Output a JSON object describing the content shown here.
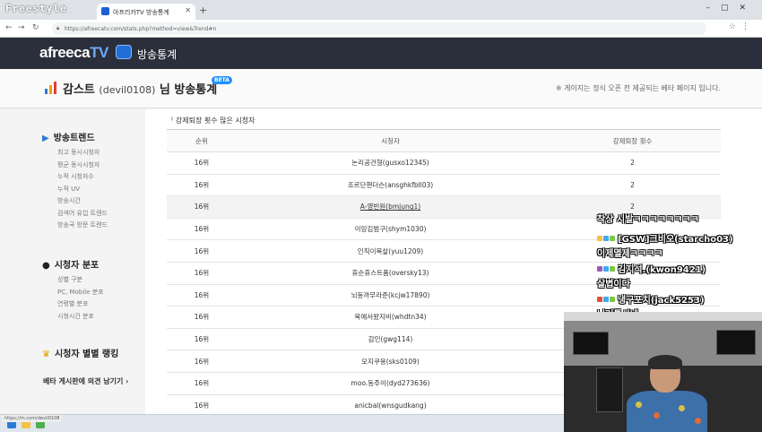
{
  "stream_logo": "Freestyle",
  "browser": {
    "tab_title": "아프리카TV 방송통계",
    "new_tab": "+",
    "url": "https://afreecatv.com/stats.php?method=view&Trend#n",
    "window_controls": "–▢✕"
  },
  "site": {
    "brand": "afreeca",
    "brand_tv": "TV",
    "section": "방송통계"
  },
  "title": {
    "name": "감스트",
    "user_id": "(devil0108)",
    "suffix": "님 방송통계",
    "beta": "BETA",
    "notice": "※ 게이지는 정식 오픈 전 제공되는 베타 페이지 입니다."
  },
  "sidebar": {
    "trend": {
      "label": "방송트렌드",
      "items": [
        "최고 동시시청자",
        "평균 동시시청자",
        "누적 시청자수",
        "누적 UV",
        "방송시간",
        "검색어 유입 트렌드",
        "방송국 방문 트렌드"
      ]
    },
    "viewers": {
      "label": "시청자 분포",
      "items": [
        "성별 구분",
        "PC, Mobile 분포",
        "연령별 분포",
        "시청시간 분포"
      ]
    },
    "ranking": {
      "label": "시청자 별별 랭킹"
    },
    "feedback": {
      "label": "베타 게시판에 의견 남기기 ›"
    }
  },
  "table": {
    "title": "강제퇴장 횟수 많은 시청자",
    "headers": [
      "순위",
      "시청자",
      "강제퇴장 횟수"
    ],
    "rows": [
      {
        "rank": "16위",
        "viewer": "논리공건형(gusxo12345)",
        "count": "2"
      },
      {
        "rank": "16위",
        "viewer": "조르단핸더슨(ansghkfbll03)",
        "count": "2"
      },
      {
        "rank": "16위",
        "viewer": "A-영빈원(bmjung1)",
        "count": "2"
      },
      {
        "rank": "16위",
        "viewer": "이잉김범구(shym1030)",
        "count": ""
      },
      {
        "rank": "16위",
        "viewer": "인직이목살(yuu1209)",
        "count": ""
      },
      {
        "rank": "16위",
        "viewer": "휴순휴스트품(oversky13)",
        "count": ""
      },
      {
        "rank": "16위",
        "viewer": "뇌동까무라준(kcjw17890)",
        "count": ""
      },
      {
        "rank": "16위",
        "viewer": "북에서왔지비(whdtn34)",
        "count": ""
      },
      {
        "rank": "16위",
        "viewer": "감인(gwg114)",
        "count": ""
      },
      {
        "rank": "16위",
        "viewer": "모지쿠용(sks0109)",
        "count": ""
      },
      {
        "rank": "16위",
        "viewer": "moo.동주이(dyd273636)",
        "count": ""
      },
      {
        "rank": "16위",
        "viewer": "anicbal(wnsgudkang)",
        "count": ""
      }
    ]
  },
  "chat": [
    {
      "user": "",
      "message": "착상 시발ㅋㅋㅋㅋㅋㅋㅋㅋ"
    },
    {
      "user": "[GSW]크비오(starcho03)",
      "message": ""
    },
    {
      "user": "",
      "message": "이제멸제ㅋㅋㅋㅋ"
    },
    {
      "user": "김지석.(kwon9421)",
      "message": ""
    },
    {
      "user": "",
      "message": "살볍이다"
    },
    {
      "user": "냉구포치(jack5253)",
      "message": ""
    },
    {
      "user": "",
      "message": "니거톡시네"
    }
  ],
  "status_url": "https://m.com/devil0108"
}
